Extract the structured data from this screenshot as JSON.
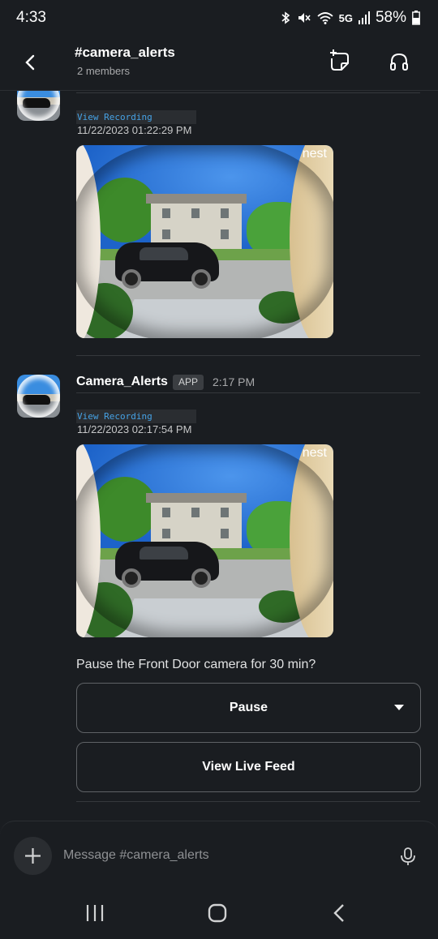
{
  "status_bar": {
    "time": "4:33",
    "network": "5G",
    "battery": "58%"
  },
  "header": {
    "channel": "#camera_alerts",
    "members": "2 members"
  },
  "messages": [
    {
      "recording_link": "View Recording",
      "timestamp": "11/22/2023 01:22:29 PM",
      "watermark": "nest"
    },
    {
      "author": "Camera_Alerts",
      "badge": "APP",
      "time": "2:17 PM",
      "recording_link": "View Recording",
      "timestamp": "11/22/2023 02:17:54 PM",
      "watermark": "nest",
      "question": "Pause the Front Door camera for 30 min?",
      "actions": {
        "pause": "Pause",
        "live_feed": "View Live Feed"
      }
    }
  ],
  "composer": {
    "placeholder": "Message #camera_alerts"
  },
  "icons": [
    "back-icon",
    "new-message-icon",
    "headphones-icon",
    "plus-icon",
    "microphone-icon",
    "recents-icon",
    "home-icon",
    "nav-back-icon",
    "bluetooth-icon",
    "mute-icon",
    "wifi-icon",
    "signal-icon",
    "battery-icon"
  ],
  "colors": {
    "background": "#1a1d21",
    "link": "#46a2e5",
    "text": "#d1d2d3"
  }
}
